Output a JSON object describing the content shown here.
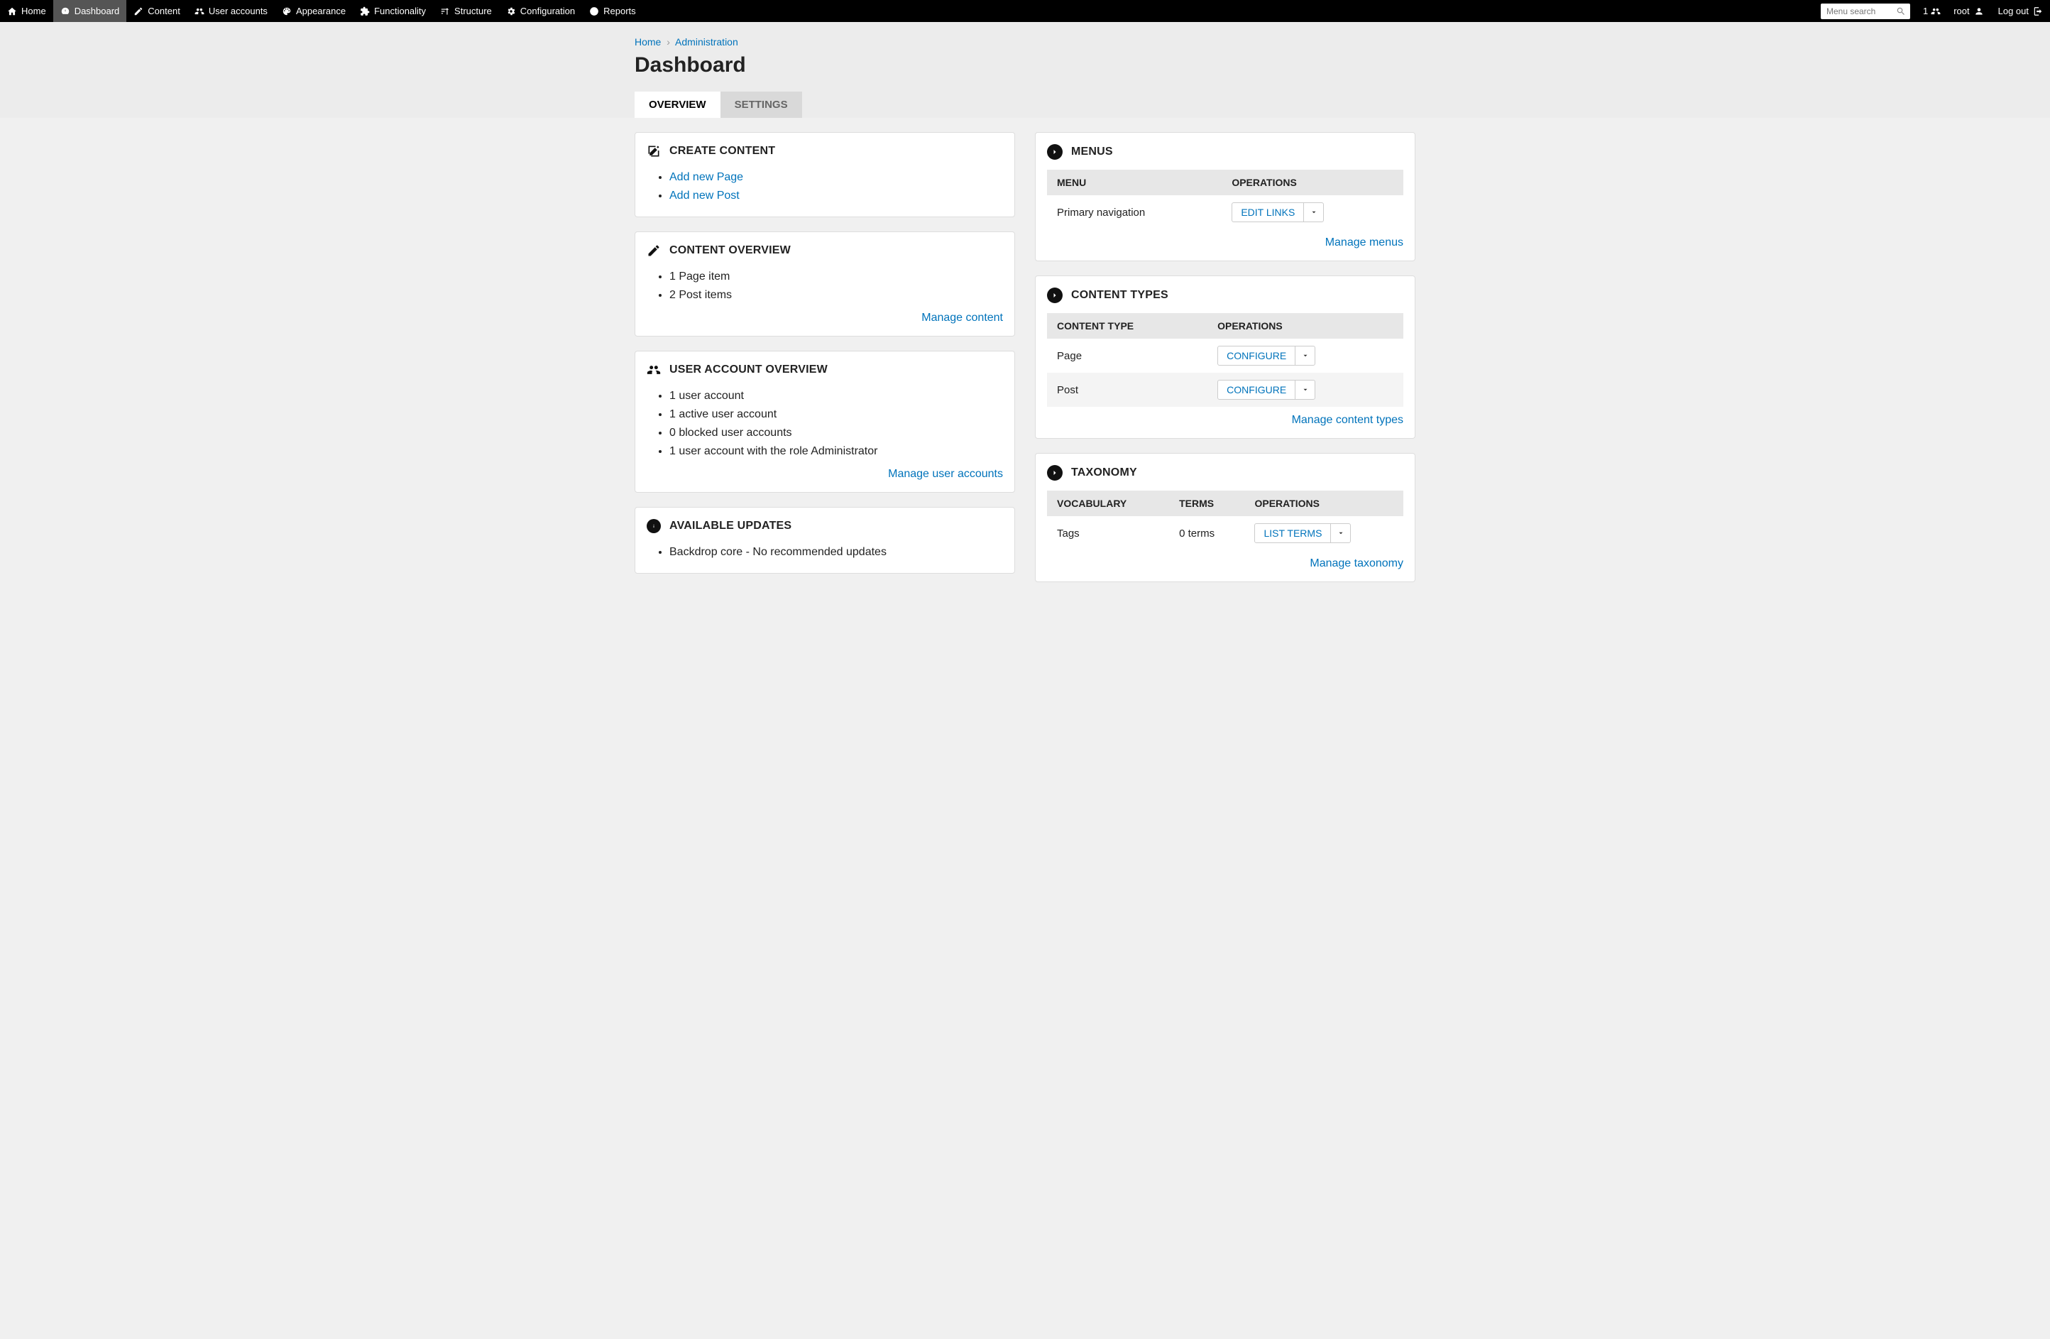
{
  "admin_bar": {
    "items": [
      {
        "label": "Home",
        "active": false
      },
      {
        "label": "Dashboard",
        "active": true
      },
      {
        "label": "Content",
        "active": false
      },
      {
        "label": "User accounts",
        "active": false
      },
      {
        "label": "Appearance",
        "active": false
      },
      {
        "label": "Functionality",
        "active": false
      },
      {
        "label": "Structure",
        "active": false
      },
      {
        "label": "Configuration",
        "active": false
      },
      {
        "label": "Reports",
        "active": false
      }
    ],
    "search_placeholder": "Menu search",
    "user_count": "1",
    "username": "root",
    "logout": "Log out"
  },
  "breadcrumbs": [
    {
      "label": "Home"
    },
    {
      "label": "Administration"
    }
  ],
  "page_title": "Dashboard",
  "tabs": [
    {
      "label": "OVERVIEW",
      "active": true
    },
    {
      "label": "SETTINGS",
      "active": false
    }
  ],
  "panels": {
    "create_content": {
      "title": "CREATE CONTENT",
      "links": [
        "Add new Page",
        "Add new Post"
      ]
    },
    "content_overview": {
      "title": "CONTENT OVERVIEW",
      "items": [
        "1 Page item",
        "2 Post items"
      ],
      "manage": "Manage content"
    },
    "user_overview": {
      "title": "USER ACCOUNT OVERVIEW",
      "items": [
        "1 user account",
        "1 active user account",
        "0 blocked user accounts",
        "1 user account with the role Administrator"
      ],
      "manage": "Manage user accounts"
    },
    "updates": {
      "title": "AVAILABLE UPDATES",
      "items": [
        "Backdrop core - No recommended updates"
      ]
    },
    "menus": {
      "title": "MENUS",
      "columns": [
        "MENU",
        "OPERATIONS"
      ],
      "rows": [
        {
          "name": "Primary navigation",
          "op": "EDIT LINKS"
        }
      ],
      "manage": "Manage menus"
    },
    "content_types": {
      "title": "CONTENT TYPES",
      "columns": [
        "CONTENT TYPE",
        "OPERATIONS"
      ],
      "rows": [
        {
          "name": "Page",
          "op": "CONFIGURE"
        },
        {
          "name": "Post",
          "op": "CONFIGURE"
        }
      ],
      "manage": "Manage content types"
    },
    "taxonomy": {
      "title": "TAXONOMY",
      "columns": [
        "VOCABULARY",
        "TERMS",
        "OPERATIONS"
      ],
      "rows": [
        {
          "name": "Tags",
          "terms": "0 terms",
          "op": "LIST TERMS"
        }
      ],
      "manage": "Manage taxonomy"
    }
  }
}
